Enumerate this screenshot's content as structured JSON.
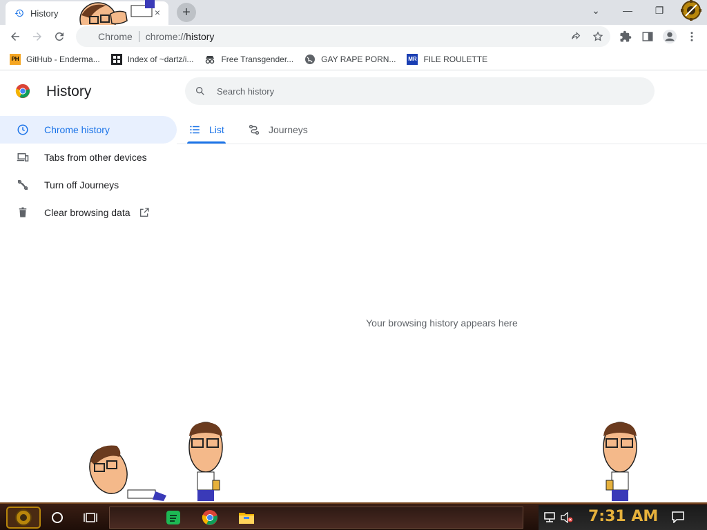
{
  "window": {
    "tab_title": "History",
    "tab_close": "×",
    "new_tab_symbol": "+",
    "controls": {
      "dropdown": "⌄",
      "minimize": "—",
      "restore": "❐",
      "close": "✕"
    }
  },
  "toolbar": {
    "omnibox_chip": "Chrome",
    "url_scheme": "chrome://",
    "url_path": "history"
  },
  "bookmarks": [
    {
      "label": "GitHub - Enderma...",
      "icon": "ph-logo",
      "badge": "PH",
      "color": "#f5a623"
    },
    {
      "label": "Index of ~dartz/i...",
      "icon": "grid-icon",
      "badge": "",
      "color": "#202124"
    },
    {
      "label": "Free Transgender...",
      "icon": "spy-icon",
      "badge": "",
      "color": "#3c4043"
    },
    {
      "label": "GAY RAPE PORN...",
      "icon": "globe-icon",
      "badge": "",
      "color": "#5f6368"
    },
    {
      "label": "FILE ROULETTE",
      "icon": "file-roulette-icon",
      "badge": "MR",
      "color": "#1a3fb3"
    }
  ],
  "history": {
    "title": "History",
    "search_placeholder": "Search history",
    "sidebar": [
      {
        "label": "Chrome history",
        "icon": "clock-icon",
        "active": true
      },
      {
        "label": "Tabs from other devices",
        "icon": "devices-icon",
        "active": false
      },
      {
        "label": "Turn off Journeys",
        "icon": "journeys-off-icon",
        "active": false
      },
      {
        "label": "Clear browsing data",
        "icon": "trash-icon",
        "active": false
      }
    ],
    "tabs": [
      {
        "label": "List",
        "icon": "list-icon",
        "active": true
      },
      {
        "label": "Journeys",
        "icon": "journeys-icon",
        "active": false
      }
    ],
    "empty_message": "Your browsing history appears here"
  },
  "taskbar": {
    "clock": "7:31 AM",
    "apps": [
      "start-button",
      "cortana-icon",
      "task-view-icon",
      "spotify-icon",
      "chrome-icon",
      "file-explorer-icon"
    ]
  },
  "colors": {
    "accent": "#1a73e8",
    "active_bg": "#e8f0fe",
    "clock": "#e6b13c"
  }
}
